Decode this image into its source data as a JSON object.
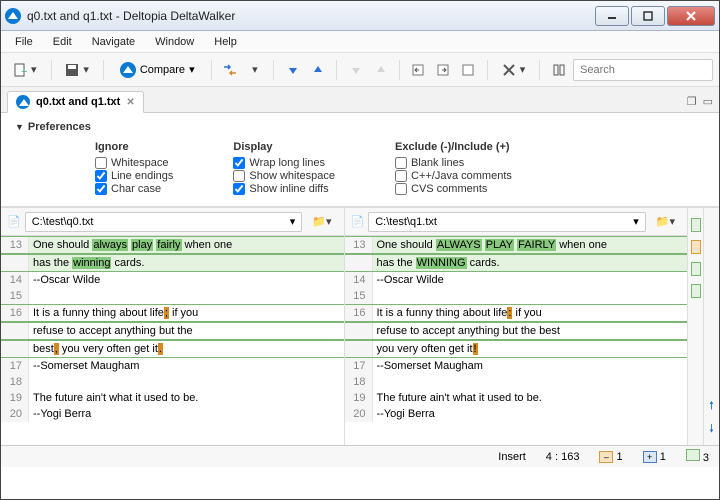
{
  "window": {
    "title": "q0.txt and q1.txt - Deltopia DeltaWalker"
  },
  "menu": [
    "File",
    "Edit",
    "Navigate",
    "Window",
    "Help"
  ],
  "toolbar": {
    "compare_label": "Compare",
    "search_placeholder": "Search"
  },
  "tab": {
    "label": "q0.txt and q1.txt"
  },
  "prefs": {
    "title": "Preferences",
    "cols": [
      {
        "title": "Ignore",
        "items": [
          {
            "label": "Whitespace",
            "checked": false
          },
          {
            "label": "Line endings",
            "checked": true
          },
          {
            "label": "Char case",
            "checked": true
          }
        ]
      },
      {
        "title": "Display",
        "items": [
          {
            "label": "Wrap long lines",
            "checked": true
          },
          {
            "label": "Show whitespace",
            "checked": false
          },
          {
            "label": "Show inline diffs",
            "checked": true
          }
        ]
      },
      {
        "title": "Exclude (-)/Include (+)",
        "items": [
          {
            "label": "Blank lines",
            "checked": false
          },
          {
            "label": "C++/Java comments",
            "checked": false
          },
          {
            "label": "CVS comments",
            "checked": false
          }
        ]
      }
    ]
  },
  "left": {
    "path": "C:\\test\\q0.txt",
    "lines": [
      {
        "n": 13,
        "pre": "One should ",
        "h": [
          "always",
          "play",
          "fairly"
        ],
        "post": " when one",
        "block": 1
      },
      {
        "n": "",
        "pre": "has the ",
        "h": [
          "winning"
        ],
        "post": " cards.",
        "block": 1
      },
      {
        "n": 14,
        "text": "--Oscar Wilde"
      },
      {
        "n": 15,
        "text": ""
      },
      {
        "n": 16,
        "text": "It is a funny thing about life; if you",
        "block": 2,
        "punct1": ";"
      },
      {
        "n": "",
        "text": "refuse to accept anything but the",
        "block": 2
      },
      {
        "n": "",
        "text": "best, you very often get it.",
        "block": 2,
        "punct2": ",",
        "punct3": "."
      },
      {
        "n": 17,
        "text": "--Somerset Maugham"
      },
      {
        "n": 18,
        "text": ""
      },
      {
        "n": 19,
        "text": "The future ain't what it used to be."
      },
      {
        "n": 20,
        "text": "--Yogi Berra"
      }
    ]
  },
  "right": {
    "path": "C:\\test\\q1.txt",
    "lines": [
      {
        "n": 13,
        "pre": "One should ",
        "h": [
          "ALWAYS",
          "PLAY",
          "FAIRLY"
        ],
        "post": " when one",
        "block": 1
      },
      {
        "n": "",
        "pre": "has the ",
        "h": [
          "WINNING"
        ],
        "post": " cards.",
        "block": 1
      },
      {
        "n": 14,
        "text": "--Oscar Wilde"
      },
      {
        "n": 15,
        "text": ""
      },
      {
        "n": 16,
        "text": "It is a funny thing about life: if you",
        "block": 2,
        "punct1": ":"
      },
      {
        "n": "",
        "text": "refuse to accept anything but the best",
        "block": 2
      },
      {
        "n": "",
        "text": "you very often get it!",
        "block": 2,
        "punct3": "!"
      },
      {
        "n": 17,
        "text": "--Somerset Maugham"
      },
      {
        "n": 18,
        "text": ""
      },
      {
        "n": 19,
        "text": "The future ain't what it used to be."
      },
      {
        "n": 20,
        "text": "--Yogi Berra"
      }
    ]
  },
  "status": {
    "mode": "Insert",
    "pos": "4 : 163",
    "counts": {
      "orange": "1",
      "blue": "1",
      "green": "3"
    }
  }
}
